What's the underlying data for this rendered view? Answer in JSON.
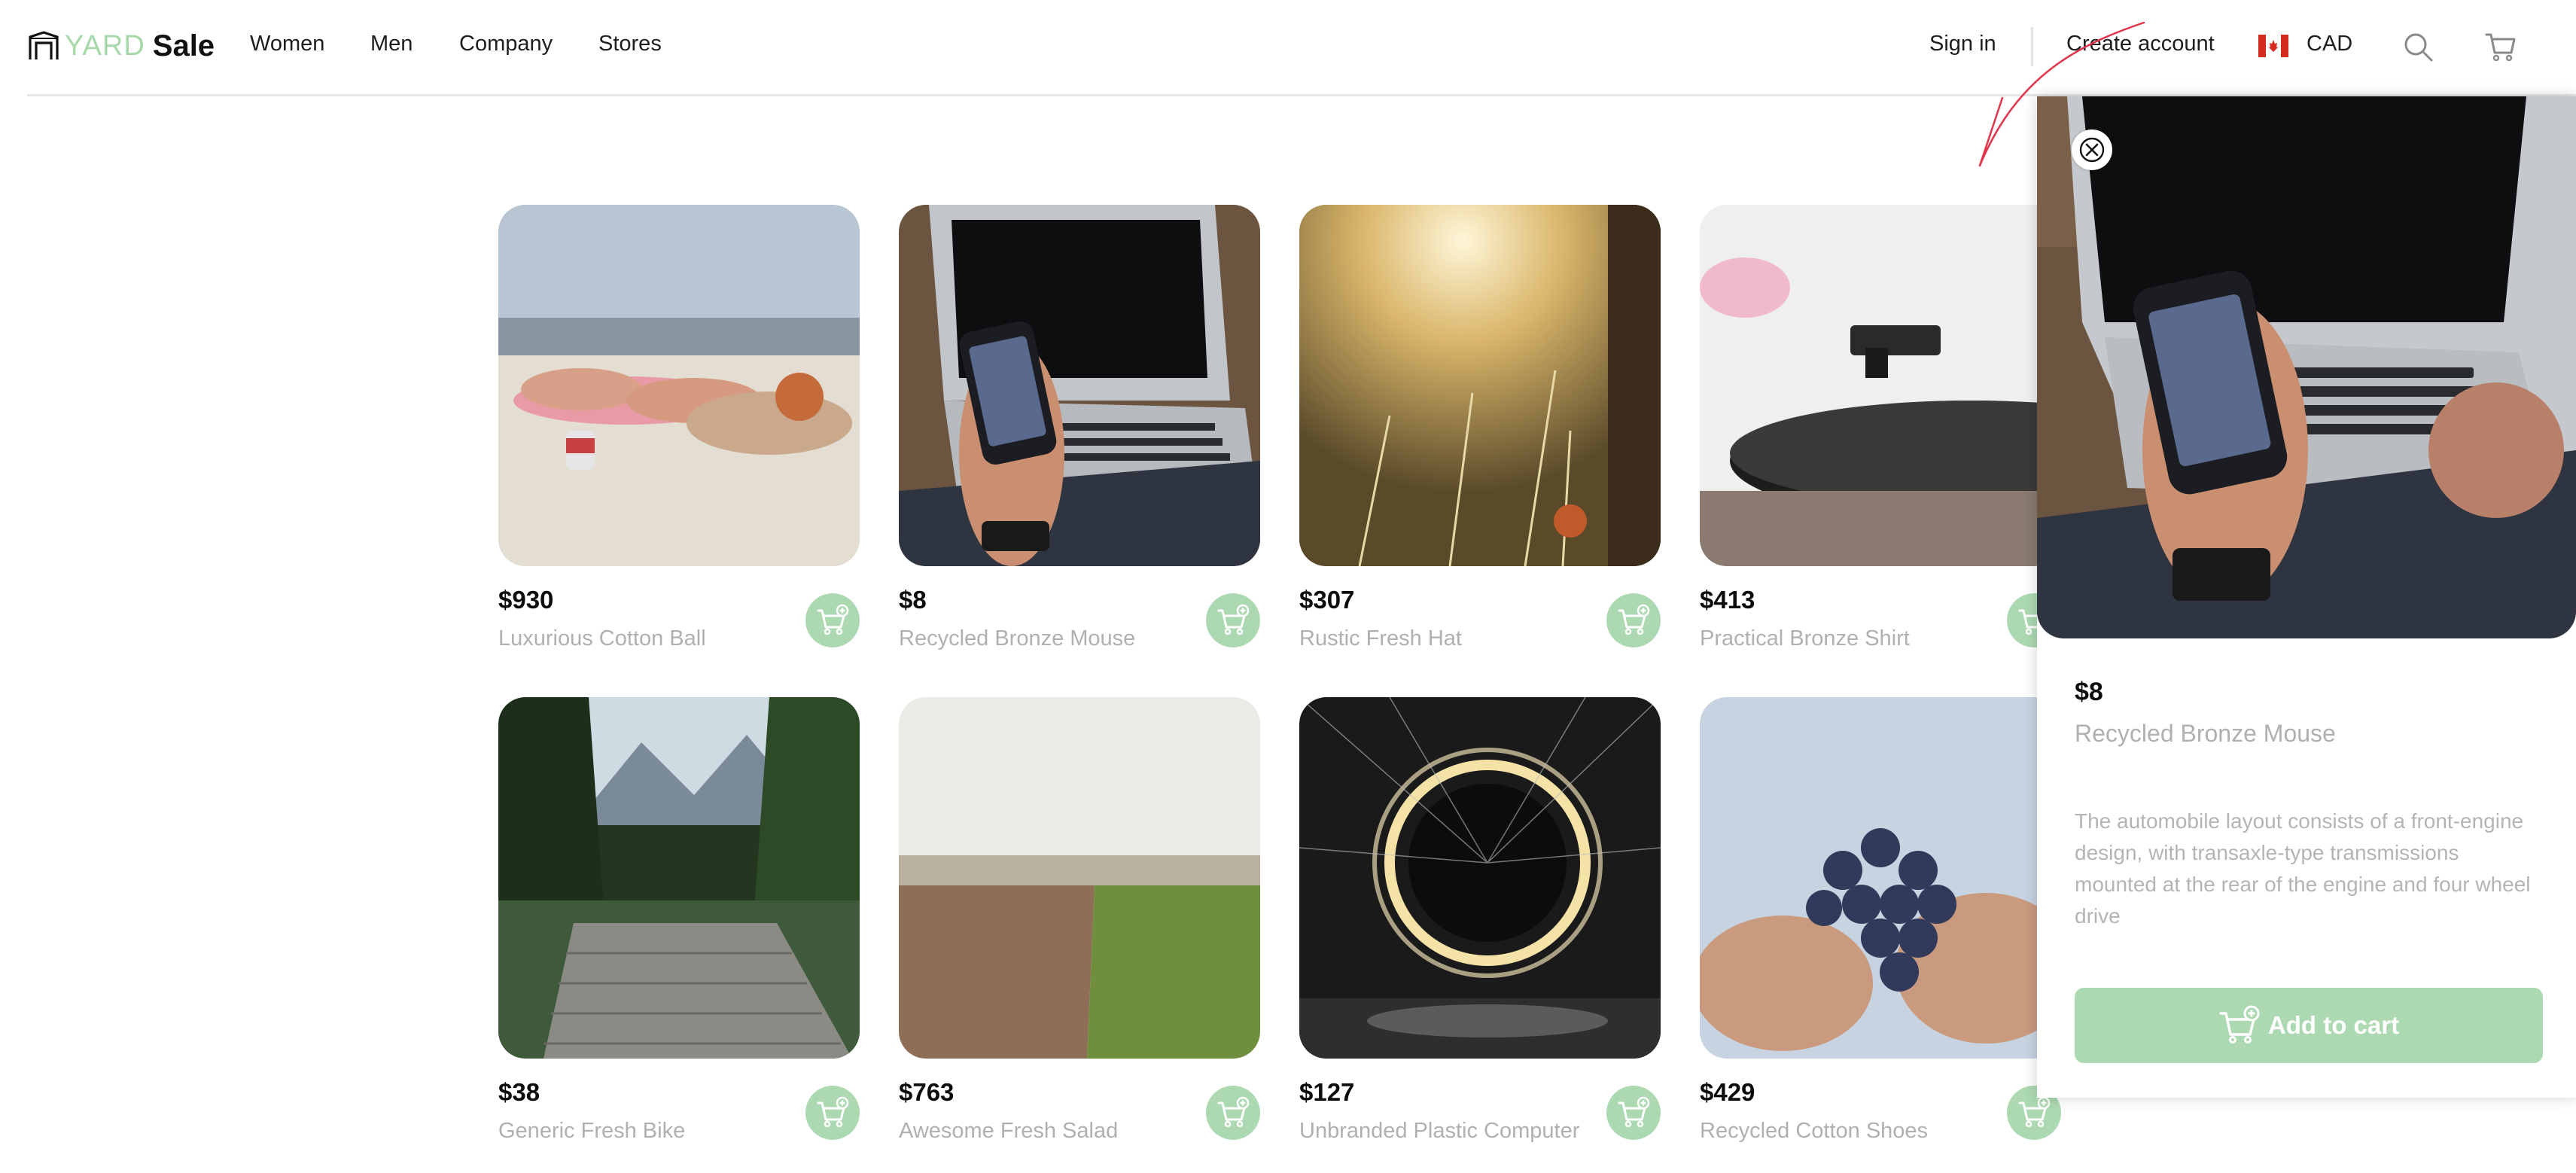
{
  "brand": {
    "part1": "YARD",
    "part2": "Sale",
    "logo_icon": "yard-sale-logo-icon"
  },
  "nav": [
    {
      "label": "Women"
    },
    {
      "label": "Men"
    },
    {
      "label": "Company"
    },
    {
      "label": "Stores"
    }
  ],
  "account": {
    "sign_in": "Sign in",
    "create_account": "Create account",
    "currency": "CAD",
    "flag_icon": "canada-flag-icon",
    "search_icon": "search-icon",
    "cart_icon": "shopping-cart-icon"
  },
  "colors": {
    "accent": "#acd9b2",
    "logo_green": "#a7d8a9",
    "muted_text": "#b0b0b0",
    "annotation": "#e0344a"
  },
  "products": [
    {
      "price": "$930",
      "name": "Luxurious Cotton Ball",
      "image": "beach-sunbathing"
    },
    {
      "price": "$8",
      "name": "Recycled Bronze Mouse",
      "image": "phone-and-laptop"
    },
    {
      "price": "$307",
      "name": "Rustic Fresh Hat",
      "image": "sunlit-grass"
    },
    {
      "price": "$413",
      "name": "Practical Bronze Shirt",
      "image": "record-player"
    },
    {
      "price": "$38",
      "name": "Generic Fresh Bike",
      "image": "lake-dock-mountains"
    },
    {
      "price": "$763",
      "name": "Awesome Fresh Salad",
      "image": "plowed-field"
    },
    {
      "price": "$127",
      "name": "Unbranded Plastic Computer",
      "image": "light-painting-ring"
    },
    {
      "price": "$429",
      "name": "Recycled Cotton Shoes",
      "image": "hands-holding-grapes"
    }
  ],
  "detail": {
    "price": "$8",
    "name": "Recycled Bronze Mouse",
    "description": "The automobile layout consists of a front-engine design, with transaxle-type transmissions mounted at the rear of the engine and four wheel drive",
    "add_to_cart": "Add to cart",
    "close_icon": "close-icon"
  }
}
